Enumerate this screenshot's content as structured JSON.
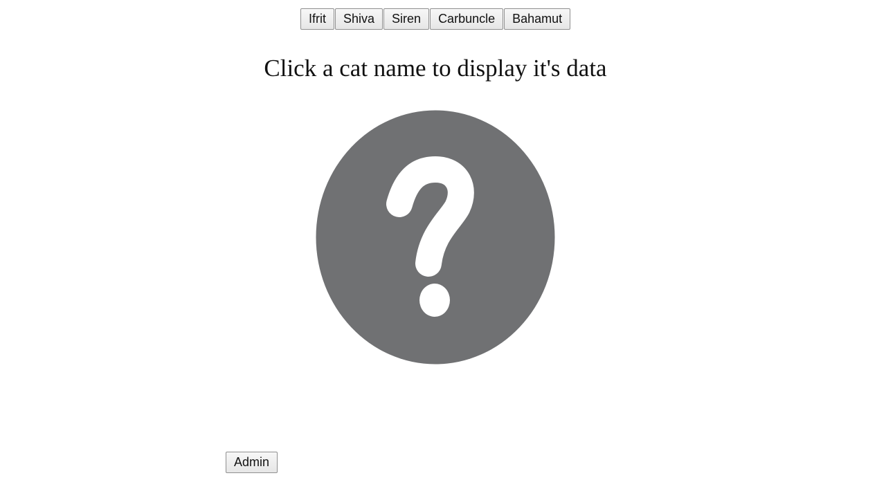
{
  "cat_buttons": [
    "Ifrit",
    "Shiva",
    "Siren",
    "Carbuncle",
    "Bahamut"
  ],
  "title": "Click a cat name to display it's data",
  "placeholder_image": {
    "icon": "question-mark-icon",
    "circle_color": "#707173",
    "glyph_color": "#ffffff"
  },
  "admin_button": "Admin"
}
